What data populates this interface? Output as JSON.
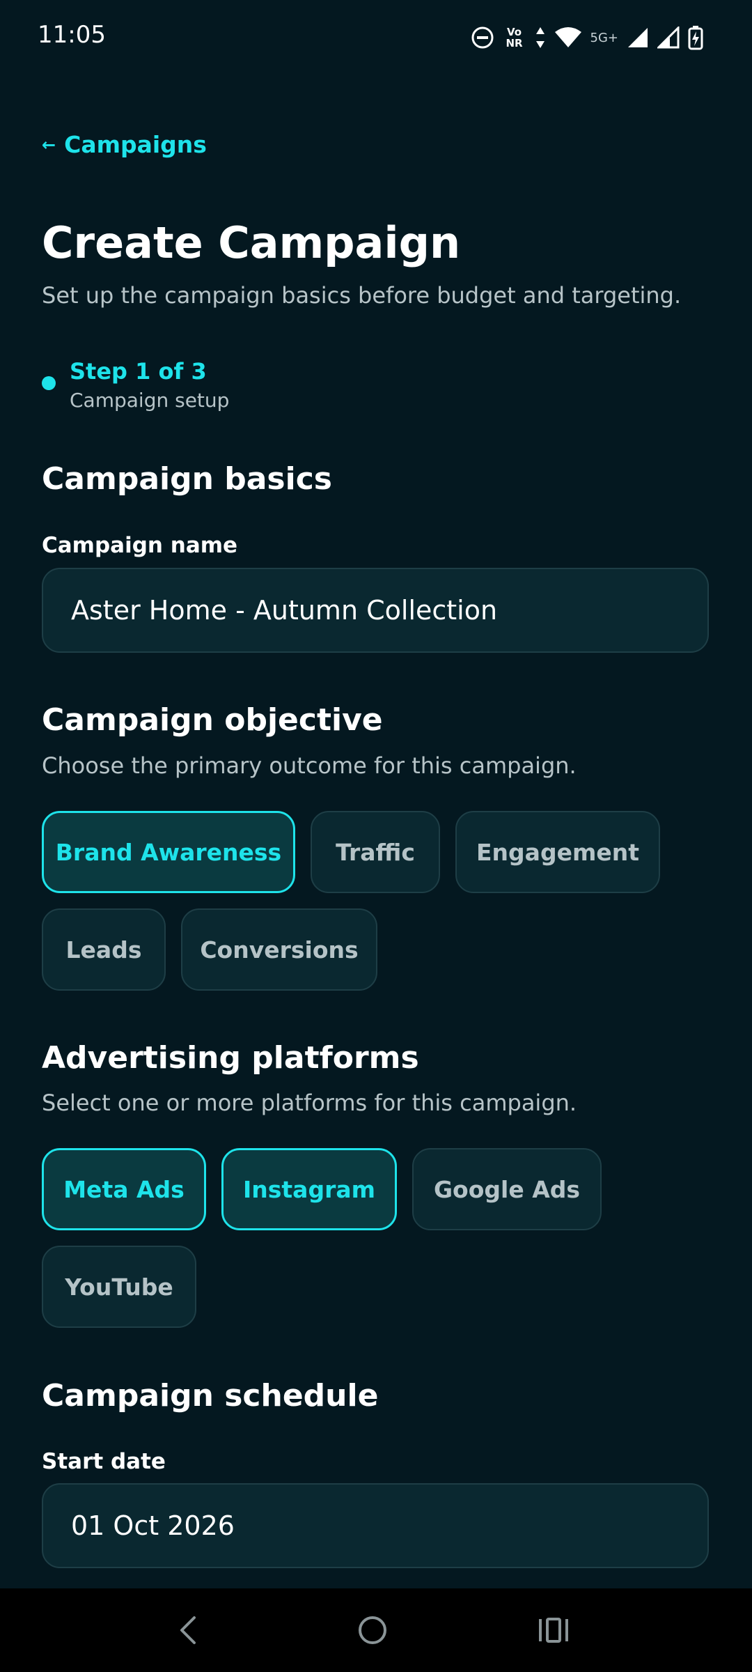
{
  "status": {
    "time": "11:05",
    "net_label": "Vo NR",
    "five_g": "5G+",
    "icons": [
      "dnd-icon",
      "vonr-icon",
      "data-arrows-icon",
      "wifi-icon",
      "signal-icon",
      "signal-icon",
      "battery-charging-icon"
    ]
  },
  "back": {
    "arrow": "←",
    "label": "Campaigns"
  },
  "page": {
    "title": "Create Campaign",
    "subtitle": "Set up the campaign basics before budget and targeting."
  },
  "step": {
    "title": "Step 1 of 3",
    "subtitle": "Campaign setup"
  },
  "basics": {
    "title": "Campaign basics",
    "name_label": "Campaign name",
    "name_value": "Aster Home - Autumn Collection"
  },
  "objective": {
    "title": "Campaign objective",
    "description": "Choose the primary outcome for this campaign.",
    "options": [
      {
        "label": "Brand Awareness",
        "selected": true
      },
      {
        "label": "Traffic",
        "selected": false
      },
      {
        "label": "Engagement",
        "selected": false
      },
      {
        "label": "Leads",
        "selected": false
      },
      {
        "label": "Conversions",
        "selected": false
      }
    ]
  },
  "platforms": {
    "title": "Advertising platforms",
    "description": "Select one or more platforms for this campaign.",
    "options": [
      {
        "label": "Meta Ads",
        "selected": true
      },
      {
        "label": "Instagram",
        "selected": true
      },
      {
        "label": "Google Ads",
        "selected": false
      },
      {
        "label": "YouTube",
        "selected": false
      }
    ]
  },
  "schedule": {
    "title": "Campaign schedule",
    "start_label": "Start date",
    "start_value": "01 Oct 2026"
  },
  "colors": {
    "background": "#041820",
    "accent": "#1ee3ea",
    "field_bg": "#0a2830",
    "field_border": "#1e3e46"
  }
}
